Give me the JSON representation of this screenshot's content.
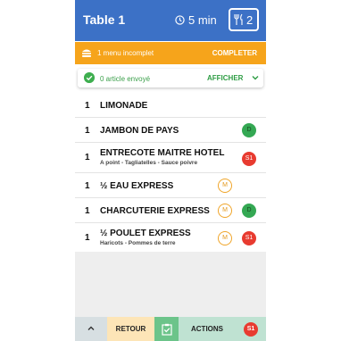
{
  "header": {
    "title": "Table 1",
    "time": "5 min",
    "covers": "2"
  },
  "banner": {
    "text": "1 menu incomplet",
    "action": "COMPLETER"
  },
  "sent": {
    "text": "0 article envoyé",
    "action": "AFFICHER"
  },
  "items": [
    {
      "qty": "1",
      "name": "LIMONADE",
      "sub": "",
      "badges": []
    },
    {
      "qty": "1",
      "name": "JAMBON DE PAYS",
      "sub": "",
      "badges": [
        "D"
      ]
    },
    {
      "qty": "1",
      "name": "ENTRECOTE MAITRE HOTEL",
      "sub": "A point - Tagliatelles - Sauce poivre",
      "badges": [
        "S1"
      ]
    },
    {
      "qty": "1",
      "name": "½ EAU EXPRESS",
      "sub": "",
      "badges": [
        "M"
      ]
    },
    {
      "qty": "1",
      "name": "CHARCUTERIE EXPRESS",
      "sub": "",
      "badges": [
        "M",
        "D"
      ]
    },
    {
      "qty": "1",
      "name": "½ POULET EXPRESS",
      "sub": "Haricots - Pommes de terre",
      "badges": [
        "M",
        "S1"
      ]
    }
  ],
  "footer": {
    "back": "RETOUR",
    "actions": "ACTIONS",
    "badge": "S1"
  },
  "colors": {
    "header": "#3c71c6",
    "banner": "#f6a41b",
    "sent_green": "#3eae4f",
    "footer_back": "#fde5b7",
    "footer_check": "#6cc48a",
    "footer_actions": "#bfe2d2",
    "footer_up": "#d7dfe2"
  }
}
